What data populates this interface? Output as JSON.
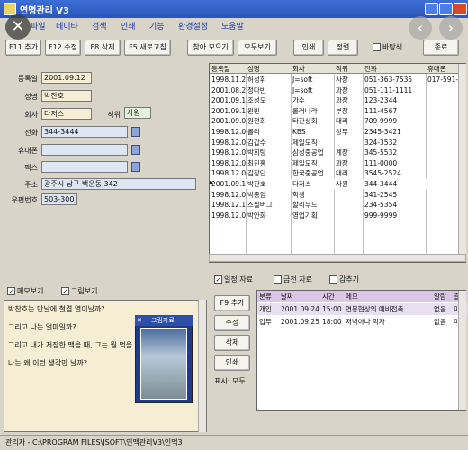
{
  "window": {
    "title": "연명관리 V3"
  },
  "menu": [
    "파일",
    "데이타",
    "검색",
    "인쇄",
    "기능",
    "환경설정",
    "도움말"
  ],
  "toolbar": {
    "f11": "F11 추가",
    "f12": "F12 수정",
    "f8": "F8 삭제",
    "f5": "F5 새로고침",
    "find": "찾아 모으기",
    "viewall": "모두보기",
    "print": "인쇄",
    "sort": "정렬",
    "bg_check": "바탕색",
    "close": "종료"
  },
  "form": {
    "labels": {
      "reg": "등록일",
      "name": "성명",
      "company": "회사",
      "title": "직위",
      "phone": "전화",
      "mobile": "휴대폰",
      "fax": "팩스",
      "address": "주소",
      "zip": "우편번호"
    },
    "values": {
      "reg": "2001.09.12",
      "name": "박찬호",
      "company": "다저스",
      "title": "사원",
      "phone": "344-3444",
      "mobile": "",
      "fax": "",
      "address": "광주시 남구 백운동 342",
      "zip": "503-300"
    }
  },
  "grid": {
    "headers": [
      "등록일",
      "성명",
      "회사",
      "직위",
      "전화",
      "휴대폰"
    ],
    "rows": [
      [
        "1998.11.26",
        "허성휘",
        "J=soft",
        "사장",
        "051-363-7535",
        "017-591-8535"
      ],
      [
        "2001.08.25",
        "정다빈",
        "J=soft",
        "과장",
        "051-111-1111",
        ""
      ],
      [
        "2001.09.10",
        "조성모",
        "가수",
        "과장",
        "123-2344",
        ""
      ],
      [
        "2001.09.11",
        "원빈",
        "롤러나라",
        "부장",
        "111-4567",
        ""
      ],
      [
        "2001.09.05",
        "원현희",
        "타잔상회",
        "대리",
        "709-9999",
        ""
      ],
      [
        "1998.12.01",
        "롤리",
        "KBS",
        "상무",
        "2345-3421",
        ""
      ],
      [
        "1998.12.01",
        "김갑수",
        "제일모직",
        "",
        "324-3532",
        ""
      ],
      [
        "1998.12.02",
        "박희탕",
        "삼성중공업",
        "계장",
        "345-5532",
        ""
      ],
      [
        "1998.12.02",
        "최진홍",
        "제일모직",
        "과장",
        "111-0000",
        ""
      ],
      [
        "1998.12.03",
        "김장단",
        "한국중공업",
        "대리",
        "3545-2524",
        ""
      ],
      [
        "2001.09.12",
        "박찬호",
        "다저스",
        "사원",
        "344-3444",
        ""
      ],
      [
        "1998.12.04",
        "박종양",
        "학생",
        "",
        "341-2545",
        ""
      ],
      [
        "1998.12.17",
        "스필버그",
        "할리우드",
        "",
        "234-5354",
        ""
      ],
      [
        "1998.12.03",
        "박안화",
        "영업기획",
        "",
        "999-9999",
        ""
      ]
    ]
  },
  "memo": {
    "check_memo": "메모보기",
    "check_pic": "그림보기",
    "lines": [
      "박찬호는 만날에 철겹 열이날까?",
      "그리고 나는 얼마일까?",
      "그리고 내가 저장한 맥을 때, 그는 뭘 먹을",
      "나는 왜 이런 생각만 날까?"
    ],
    "photo_title": "그림자료"
  },
  "schedule": {
    "tabs": [
      "일정 자료",
      "금전 자료",
      "감추기"
    ],
    "buttons": {
      "add": "F9 추가",
      "edit": "수정",
      "del": "삭제",
      "print": "인쇄"
    },
    "show_label": "표시: 모두",
    "headers": [
      "분류",
      "날짜",
      "시간",
      "메모",
      "알람",
      "결과"
    ],
    "rows": [
      [
        "개인",
        "2001.09.24",
        "15:00",
        "연봉협상의 예비접촉",
        "없음",
        "미결"
      ],
      [
        "업무",
        "2001.09.25",
        "18:00",
        "저녁아나 먹자",
        "없음",
        "미결"
      ]
    ]
  },
  "status": "관리자 - C:\\PROGRAM FILES\\JSOFT\\인맥관리V3\\인맥3",
  "overlay": {
    "close": "✕",
    "prev": "‹",
    "next": "›"
  }
}
